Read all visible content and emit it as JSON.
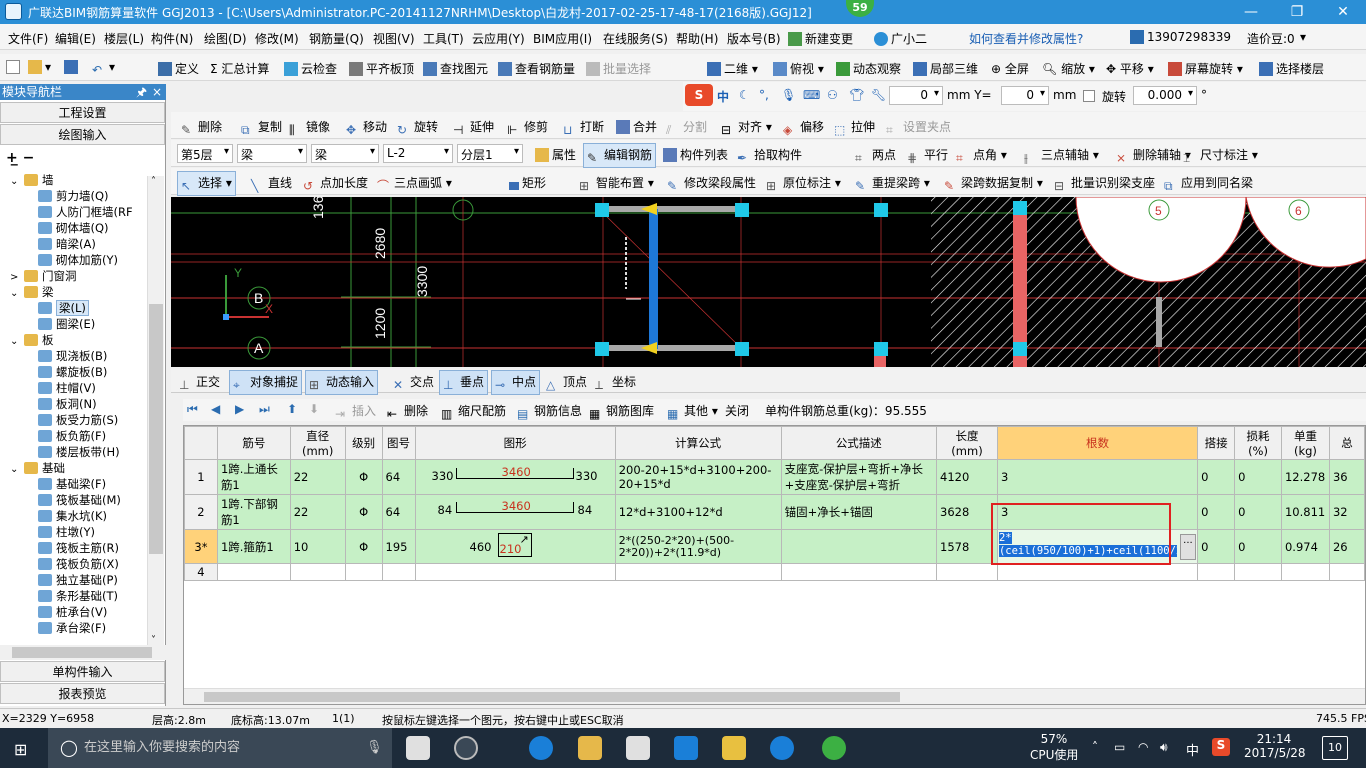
{
  "window": {
    "title": "广联达BIM钢筋算量软件 GGJ2013 - [C:\\Users\\Administrator.PC-20141127NRHM\\Desktop\\白龙村-2017-02-25-17-48-17(2168版).GGJ12]",
    "badge": "59",
    "min": "—",
    "max": "❐",
    "close": "✕"
  },
  "menu": {
    "items": [
      "文件(F)",
      "编辑(E)",
      "楼层(L)",
      "构件(N)",
      "绘图(D)",
      "修改(M)",
      "钢筋量(Q)",
      "视图(V)",
      "工具(T)",
      "云应用(Y)",
      "BIM应用(I)",
      "在线服务(S)",
      "帮助(H)",
      "版本号(B)",
      "新建变更",
      "广小二"
    ],
    "hint": "如何查看并修改属性?",
    "phone": "13907298339",
    "price": "造价豆:0"
  },
  "toolbar1": {
    "items": [
      "定义",
      "汇总计算",
      "云检查",
      "平齐板顶",
      "查找图元",
      "查看钢筋量",
      "批量选择",
      "二维",
      "俯视",
      "动态观察",
      "局部三维",
      "全屏",
      "缩放",
      "平移",
      "屏幕旋转",
      "选择楼层"
    ]
  },
  "toolbar2": {
    "x_label": "mm Y=",
    "x_val": "0",
    "y_val": "0",
    "y_unit": "mm",
    "rotate_label": "旋转",
    "rotate_val": "0.000",
    "deg": "°",
    "ime": "中"
  },
  "toolbar3": {
    "items": [
      "删除",
      "复制",
      "镜像",
      "移动",
      "旋转",
      "延伸",
      "修剪",
      "打断",
      "合并",
      "分割",
      "对齐",
      "偏移",
      "拉伸",
      "设置夹点"
    ]
  },
  "toolbar4": {
    "floor": "第5层",
    "type1": "梁",
    "type2": "梁",
    "name": "L-2",
    "layer": "分层1",
    "items": [
      "属性",
      "编辑钢筋",
      "构件列表",
      "拾取构件",
      "两点",
      "平行",
      "点角",
      "三点辅轴",
      "删除辅轴",
      "尺寸标注"
    ]
  },
  "toolbar5": {
    "items": [
      "选择",
      "直线",
      "点加长度",
      "三点画弧",
      "矩形",
      "智能布置",
      "修改梁段属性",
      "原位标注",
      "重提梁跨",
      "梁跨数据复制",
      "批量识别梁支座",
      "应用到同名梁"
    ]
  },
  "leftpanel": {
    "title": "模块导航栏",
    "pin": "ꟷ",
    "close": "×",
    "btn1": "工程设置",
    "btn2": "绘图输入",
    "btn3": "单构件输入",
    "btn4": "报表预览",
    "tree": [
      {
        "label": "墙",
        "level": 0,
        "folder": true,
        "exp": "⌄"
      },
      {
        "label": "剪力墙(Q)",
        "level": 1
      },
      {
        "label": "人防门框墙(RF",
        "level": 1
      },
      {
        "label": "砌体墙(Q)",
        "level": 1
      },
      {
        "label": "暗梁(A)",
        "level": 1
      },
      {
        "label": "砌体加筋(Y)",
        "level": 1
      },
      {
        "label": "门窗洞",
        "level": 0,
        "folder": true,
        "exp": ">"
      },
      {
        "label": "梁",
        "level": 0,
        "folder": true,
        "exp": "⌄"
      },
      {
        "label": "梁(L)",
        "level": 1,
        "sel": true
      },
      {
        "label": "圈梁(E)",
        "level": 1
      },
      {
        "label": "板",
        "level": 0,
        "folder": true,
        "exp": "⌄"
      },
      {
        "label": "现浇板(B)",
        "level": 1
      },
      {
        "label": "螺旋板(B)",
        "level": 1
      },
      {
        "label": "柱帽(V)",
        "level": 1
      },
      {
        "label": "板洞(N)",
        "level": 1
      },
      {
        "label": "板受力筋(S)",
        "level": 1
      },
      {
        "label": "板负筋(F)",
        "level": 1
      },
      {
        "label": "楼层板带(H)",
        "level": 1
      },
      {
        "label": "基础",
        "level": 0,
        "folder": true,
        "exp": "⌄"
      },
      {
        "label": "基础梁(F)",
        "level": 1
      },
      {
        "label": "筏板基础(M)",
        "level": 1
      },
      {
        "label": "集水坑(K)",
        "level": 1
      },
      {
        "label": "柱墩(Y)",
        "level": 1
      },
      {
        "label": "筏板主筋(R)",
        "level": 1
      },
      {
        "label": "筏板负筋(X)",
        "level": 1
      },
      {
        "label": "独立基础(P)",
        "level": 1
      },
      {
        "label": "条形基础(T)",
        "level": 1
      },
      {
        "label": "桩承台(V)",
        "level": 1
      },
      {
        "label": "承台梁(F)",
        "level": 1
      }
    ]
  },
  "canvas": {
    "dim1": "2680",
    "dim2": "3300",
    "dim3": "1200",
    "dim4": "136",
    "axisB": "B",
    "axisA": "A",
    "axis5": "5",
    "axis6": "6",
    "y": "Y",
    "x": "X"
  },
  "snapbar": {
    "items": [
      "正交",
      "对象捕捉",
      "动态输入",
      "交点",
      "垂点",
      "中点",
      "顶点",
      "坐标"
    ]
  },
  "gridtb": {
    "items": [
      "插入",
      "删除",
      "缩尺配筋",
      "钢筋信息",
      "钢筋图库",
      "其他",
      "关闭"
    ],
    "total": "单构件钢筋总重(kg)：95.555"
  },
  "grid": {
    "headers": [
      "",
      "筋号",
      "直径(mm)",
      "级别",
      "图号",
      "图形",
      "计算公式",
      "公式描述",
      "长度(mm)",
      "根数",
      "搭接",
      "损耗(%)",
      "单重(kg)",
      "总"
    ],
    "rows": [
      {
        "n": "1",
        "name": "1跨.上通长筋1",
        "dia": "22",
        "grade": "Φ",
        "fig": "64",
        "s_left": "330",
        "s_mid": "3460",
        "s_right": "330",
        "formula": "200-20+15*d+3100+200-20+15*d",
        "desc": "支座宽-保护层+弯折+净长+支座宽-保护层+弯折",
        "len": "4120",
        "count": "3",
        "lap": "0",
        "loss": "0",
        "unit": "12.278",
        "tot": "36"
      },
      {
        "n": "2",
        "name": "1跨.下部钢筋1",
        "dia": "22",
        "grade": "Φ",
        "fig": "64",
        "s_left": "84",
        "s_mid": "3460",
        "s_right": "84",
        "formula": "12*d+3100+12*d",
        "desc": "锚固+净长+锚固",
        "len": "3628",
        "count": "3",
        "lap": "0",
        "loss": "0",
        "unit": "10.811",
        "tot": "32"
      },
      {
        "n": "3*",
        "name": "1跨.箍筋1",
        "dia": "10",
        "grade": "Φ",
        "fig": "195",
        "s_left": "460",
        "s_mid": "210",
        "s_right": "",
        "formula": "2*((250-2*20)+(500-2*20))+2*(11.9*d)",
        "desc": "",
        "len": "1578",
        "count": "2*(ceil(950/100)+1)+ceil(1100/200)-1",
        "lap": "0",
        "loss": "0",
        "unit": "0.974",
        "tot": "26"
      },
      {
        "n": "4",
        "name": "",
        "dia": "",
        "grade": "",
        "fig": "",
        "s_left": "",
        "s_mid": "",
        "s_right": "",
        "formula": "",
        "desc": "",
        "len": "",
        "count": "",
        "lap": "",
        "loss": "",
        "unit": "",
        "tot": ""
      }
    ]
  },
  "status": {
    "coords": "X=2329 Y=6958",
    "floor_h": "层高:2.8m",
    "base_h": "底标高:13.07m",
    "idx": "1(1)",
    "msg": "按鼠标左键选择一个图元，按右键中止或ESC取消",
    "fps": "745.5 FPS"
  },
  "taskbar": {
    "search": "在这里输入你要搜索的内容",
    "cpu": "57%",
    "cpu_label": "CPU使用",
    "ime": "中",
    "time": "21:14",
    "date": "2017/5/28",
    "notif": "10"
  }
}
